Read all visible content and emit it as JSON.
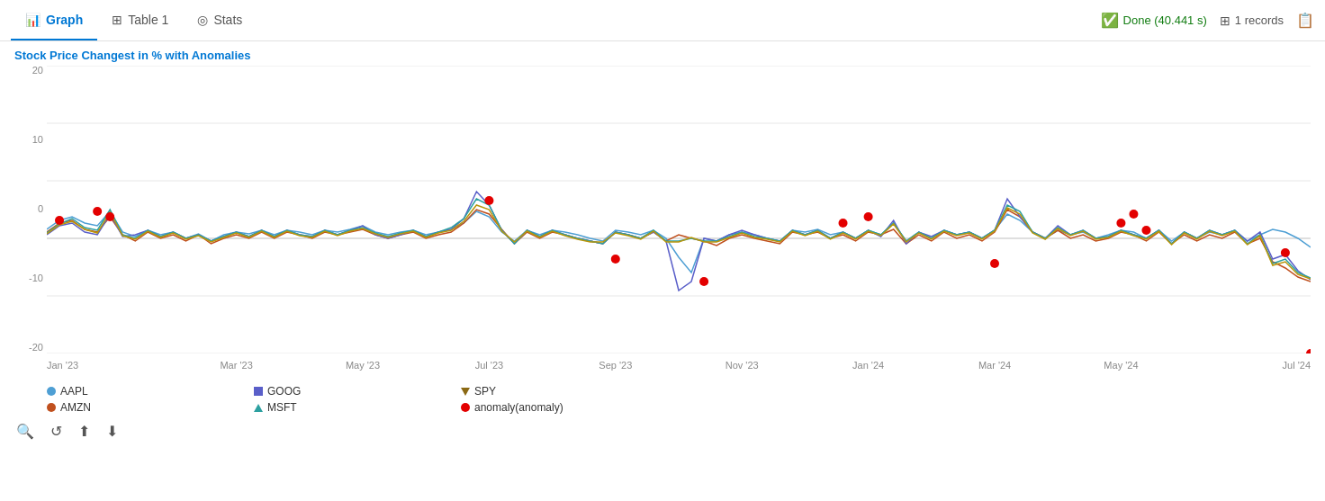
{
  "tabs": [
    {
      "id": "graph",
      "label": "Graph",
      "icon": "📊",
      "active": true
    },
    {
      "id": "table1",
      "label": "Table 1",
      "icon": "⊞",
      "active": false
    },
    {
      "id": "stats",
      "label": "Stats",
      "icon": "◎",
      "active": false
    }
  ],
  "status": {
    "done_label": "Done (40.441 s)",
    "records_label": "1 records"
  },
  "chart": {
    "title": "Stock Price Changest in % with Anomalies",
    "y_labels": [
      "20",
      "10",
      "0",
      "-10",
      "-20"
    ],
    "x_labels": [
      "Jan '23",
      "Mar '23",
      "May '23",
      "Jul '23",
      "Sep '23",
      "Nov '23",
      "Jan '24",
      "Mar '24",
      "May '24",
      "Jul '24"
    ]
  },
  "legend": {
    "row1": [
      {
        "type": "dot",
        "color": "#4e9fd4",
        "label": "AAPL"
      },
      {
        "type": "square",
        "color": "#5a5fc9",
        "label": "GOOG"
      },
      {
        "type": "triangle",
        "color": "#8B6914",
        "label": "SPY"
      }
    ],
    "row2": [
      {
        "type": "dot",
        "color": "#c0501e",
        "label": "AMZN"
      },
      {
        "type": "triangle_up",
        "color": "#2ca0a0",
        "label": "MSFT"
      },
      {
        "type": "dot",
        "color": "#e30000",
        "label": "anomaly(anomaly)"
      }
    ]
  },
  "toolbar": {
    "buttons": [
      "🔍",
      "↺",
      "⬆",
      "⬇"
    ]
  }
}
